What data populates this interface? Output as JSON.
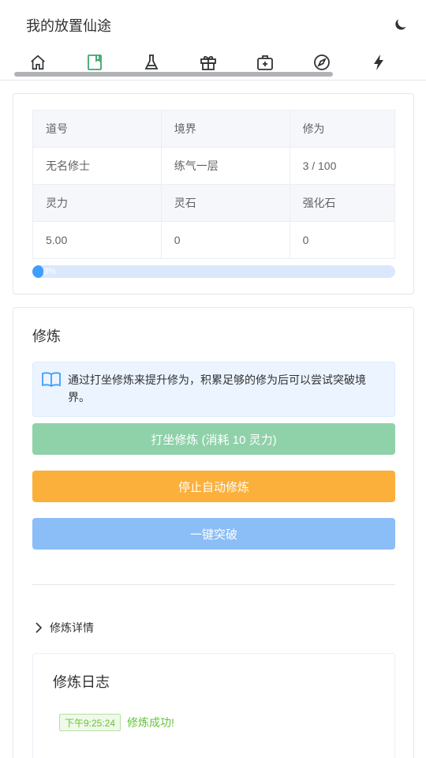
{
  "app": {
    "title": "我的放置仙途"
  },
  "tabs": [
    {
      "icon": "home-icon",
      "active": false
    },
    {
      "icon": "book-icon",
      "active": true
    },
    {
      "icon": "flask-icon",
      "active": false
    },
    {
      "icon": "gift-icon",
      "active": false
    },
    {
      "icon": "medkit-icon",
      "active": false
    },
    {
      "icon": "compass-icon",
      "active": false
    },
    {
      "icon": "lightning-icon",
      "active": false
    }
  ],
  "stats": {
    "headers1": [
      "道号",
      "境界",
      "修为"
    ],
    "values1": [
      "无名修士",
      "练气一层",
      "3 / 100"
    ],
    "headers2": [
      "灵力",
      "灵石",
      "强化石"
    ],
    "values2": [
      "5.00",
      "0",
      "0"
    ]
  },
  "progress": {
    "percent": 3,
    "label": "3%"
  },
  "cultivate": {
    "title": "修炼",
    "info": "通过打坐修炼来提升修为，积累足够的修为后可以尝试突破境界。",
    "meditate_label": "打坐修炼 (消耗 10 灵力)",
    "stop_label": "停止自动修炼",
    "breakthrough_label": "一键突破",
    "details_label": "修炼详情"
  },
  "log": {
    "title": "修炼日志",
    "entries": [
      {
        "time": "下午9:25:24",
        "message": "修炼成功!"
      }
    ]
  },
  "colors": {
    "accent": "#409eff",
    "success": "#67c23a",
    "warning": "#fbb03b",
    "active_tab": "#3fa56b"
  }
}
